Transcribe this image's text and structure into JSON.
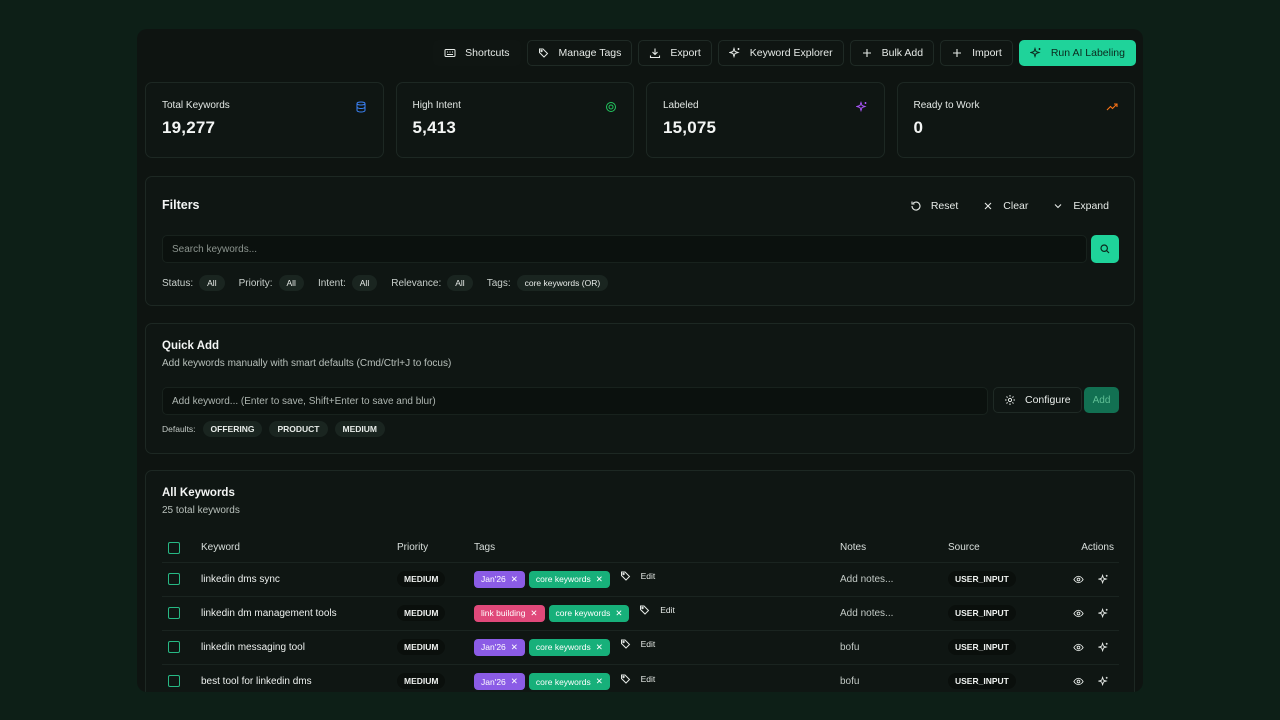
{
  "toolbar": {
    "shortcuts": "Shortcuts",
    "manage_tags": "Manage Tags",
    "export": "Export",
    "keyword_explorer": "Keyword Explorer",
    "bulk_add": "Bulk Add",
    "import": "Import",
    "run_ai": "Run AI Labeling"
  },
  "stats": [
    {
      "label": "Total Keywords",
      "value": "19,277",
      "icon": "database-icon",
      "color": "#3b82f6"
    },
    {
      "label": "High Intent",
      "value": "5,413",
      "icon": "target-icon",
      "color": "#22c55e"
    },
    {
      "label": "Labeled",
      "value": "15,075",
      "icon": "sparkle-icon",
      "color": "#a855f7"
    },
    {
      "label": "Ready to Work",
      "value": "0",
      "icon": "trending-up-icon",
      "color": "#f97316"
    }
  ],
  "filters": {
    "title": "Filters",
    "reset": "Reset",
    "clear": "Clear",
    "expand": "Expand",
    "search_placeholder": "Search keywords...",
    "status_label": "Status:",
    "status_value": "All",
    "priority_label": "Priority:",
    "priority_value": "All",
    "intent_label": "Intent:",
    "intent_value": "All",
    "relevance_label": "Relevance:",
    "relevance_value": "All",
    "tags_label": "Tags:",
    "tags_value": "core keywords (OR)"
  },
  "quick_add": {
    "title": "Quick Add",
    "subtitle": "Add keywords manually with smart defaults (Cmd/Ctrl+J to focus)",
    "placeholder": "Add keyword... (Enter to save, Shift+Enter to save and blur)",
    "configure": "Configure",
    "add": "Add",
    "defaults_label": "Defaults:",
    "defaults": [
      "OFFERING",
      "PRODUCT",
      "MEDIUM"
    ]
  },
  "all_keywords": {
    "title": "All Keywords",
    "subtitle": "25 total keywords",
    "columns": {
      "keyword": "Keyword",
      "priority": "Priority",
      "tags": "Tags",
      "notes": "Notes",
      "source": "Source",
      "actions": "Actions"
    },
    "edit_label": "Edit",
    "rows": [
      {
        "keyword": "linkedin dms sync",
        "priority": "MEDIUM",
        "tag1": "Jan'26",
        "tag2": "core keywords",
        "notes": "Add notes...",
        "source": "USER_INPUT"
      },
      {
        "keyword": "linkedin dm management tools",
        "priority": "MEDIUM",
        "tag1": "link building",
        "tag2": "core keywords",
        "notes": "Add notes...",
        "source": "USER_INPUT"
      },
      {
        "keyword": "linkedin messaging tool",
        "priority": "MEDIUM",
        "tag1": "Jan'26",
        "tag2": "core keywords",
        "notes": "bofu",
        "source": "USER_INPUT"
      },
      {
        "keyword": "best tool for linkedin dms",
        "priority": "MEDIUM",
        "tag1": "Jan'26",
        "tag2": "core keywords",
        "notes": "bofu",
        "source": "USER_INPUT"
      }
    ]
  }
}
